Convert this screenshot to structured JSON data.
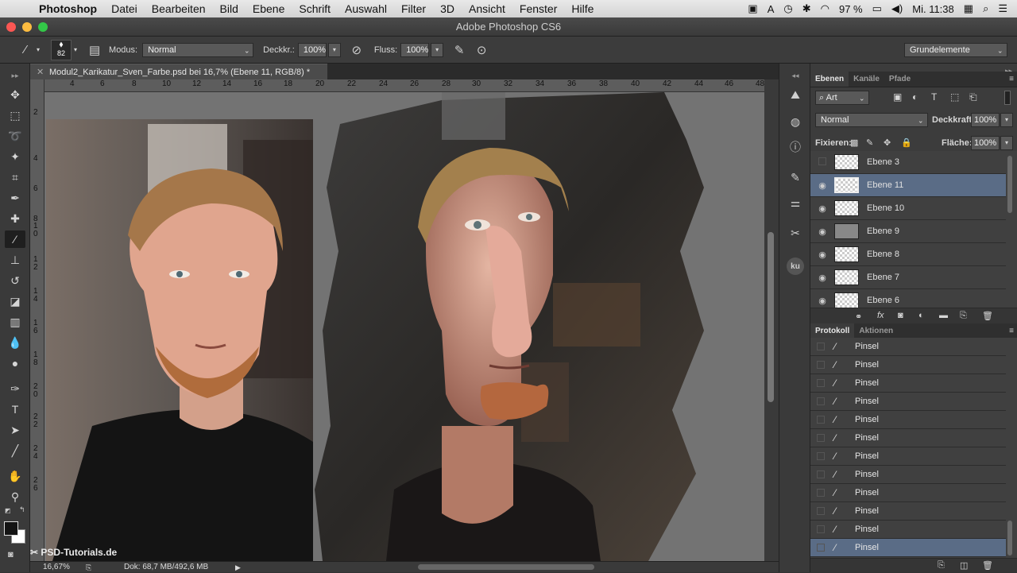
{
  "menubar": {
    "app": "Photoshop",
    "items": [
      "Datei",
      "Bearbeiten",
      "Bild",
      "Ebene",
      "Schrift",
      "Auswahl",
      "Filter",
      "3D",
      "Ansicht",
      "Fenster",
      "Hilfe"
    ],
    "battery": "97 %",
    "clock": "Mi. 11:38"
  },
  "window": {
    "title": "Adobe Photoshop CS6"
  },
  "options": {
    "brush_size": "82",
    "mode_label": "Modus:",
    "mode_value": "Normal",
    "opacity_label": "Deckkr.:",
    "opacity_value": "100%",
    "flow_label": "Fluss:",
    "flow_value": "100%",
    "workspace": "Grundelemente"
  },
  "document": {
    "tab_title": "Modul2_Karikatur_Sven_Farbe.psd bei 16,7% (Ebene 11, RGB/8) *"
  },
  "ruler": {
    "top_ticks": [
      "4",
      "8",
      "12",
      "16",
      "20",
      "24",
      "28",
      "32",
      "36",
      "40",
      "44",
      "48"
    ],
    "top_ticks_b": [
      "6",
      "10",
      "14",
      "18",
      "22",
      "26",
      "30",
      "34",
      "38",
      "42",
      "46"
    ],
    "left_ticks": [
      "2",
      "4",
      "6",
      "8",
      "1 0",
      "1 2",
      "1 4",
      "1 6",
      "1 8",
      "2 0",
      "2 2",
      "2 4",
      "2 6"
    ]
  },
  "status": {
    "zoom": "16,67%",
    "doc": "Dok: 68,7 MB/492,6 MB",
    "watermark": "PSD-Tutorials.de"
  },
  "layers_panel": {
    "tabs": [
      "Ebenen",
      "Kanäle",
      "Pfade"
    ],
    "filter": "Art",
    "blend_mode": "Normal",
    "opacity_label": "Deckkraft:",
    "opacity_value": "100%",
    "lock_label": "Fixieren:",
    "fill_label": "Fläche:",
    "fill_value": "100%",
    "layers": [
      {
        "name": "Ebene 3",
        "visible": false,
        "selected": false
      },
      {
        "name": "Ebene 11",
        "visible": true,
        "selected": true
      },
      {
        "name": "Ebene 10",
        "visible": true,
        "selected": false
      },
      {
        "name": "Ebene 9",
        "visible": true,
        "selected": false
      },
      {
        "name": "Ebene 8",
        "visible": true,
        "selected": false
      },
      {
        "name": "Ebene 7",
        "visible": true,
        "selected": false
      },
      {
        "name": "Ebene 6",
        "visible": true,
        "selected": false
      }
    ]
  },
  "history_panel": {
    "tabs": [
      "Protokoll",
      "Aktionen"
    ],
    "items": [
      "Pinsel",
      "Pinsel",
      "Pinsel",
      "Pinsel",
      "Pinsel",
      "Pinsel",
      "Pinsel",
      "Pinsel",
      "Pinsel",
      "Pinsel",
      "Pinsel",
      "Pinsel"
    ],
    "selected_index": 11
  },
  "colors": {
    "accent_selection": "#5a6c86",
    "ui_dark": "#323232"
  }
}
